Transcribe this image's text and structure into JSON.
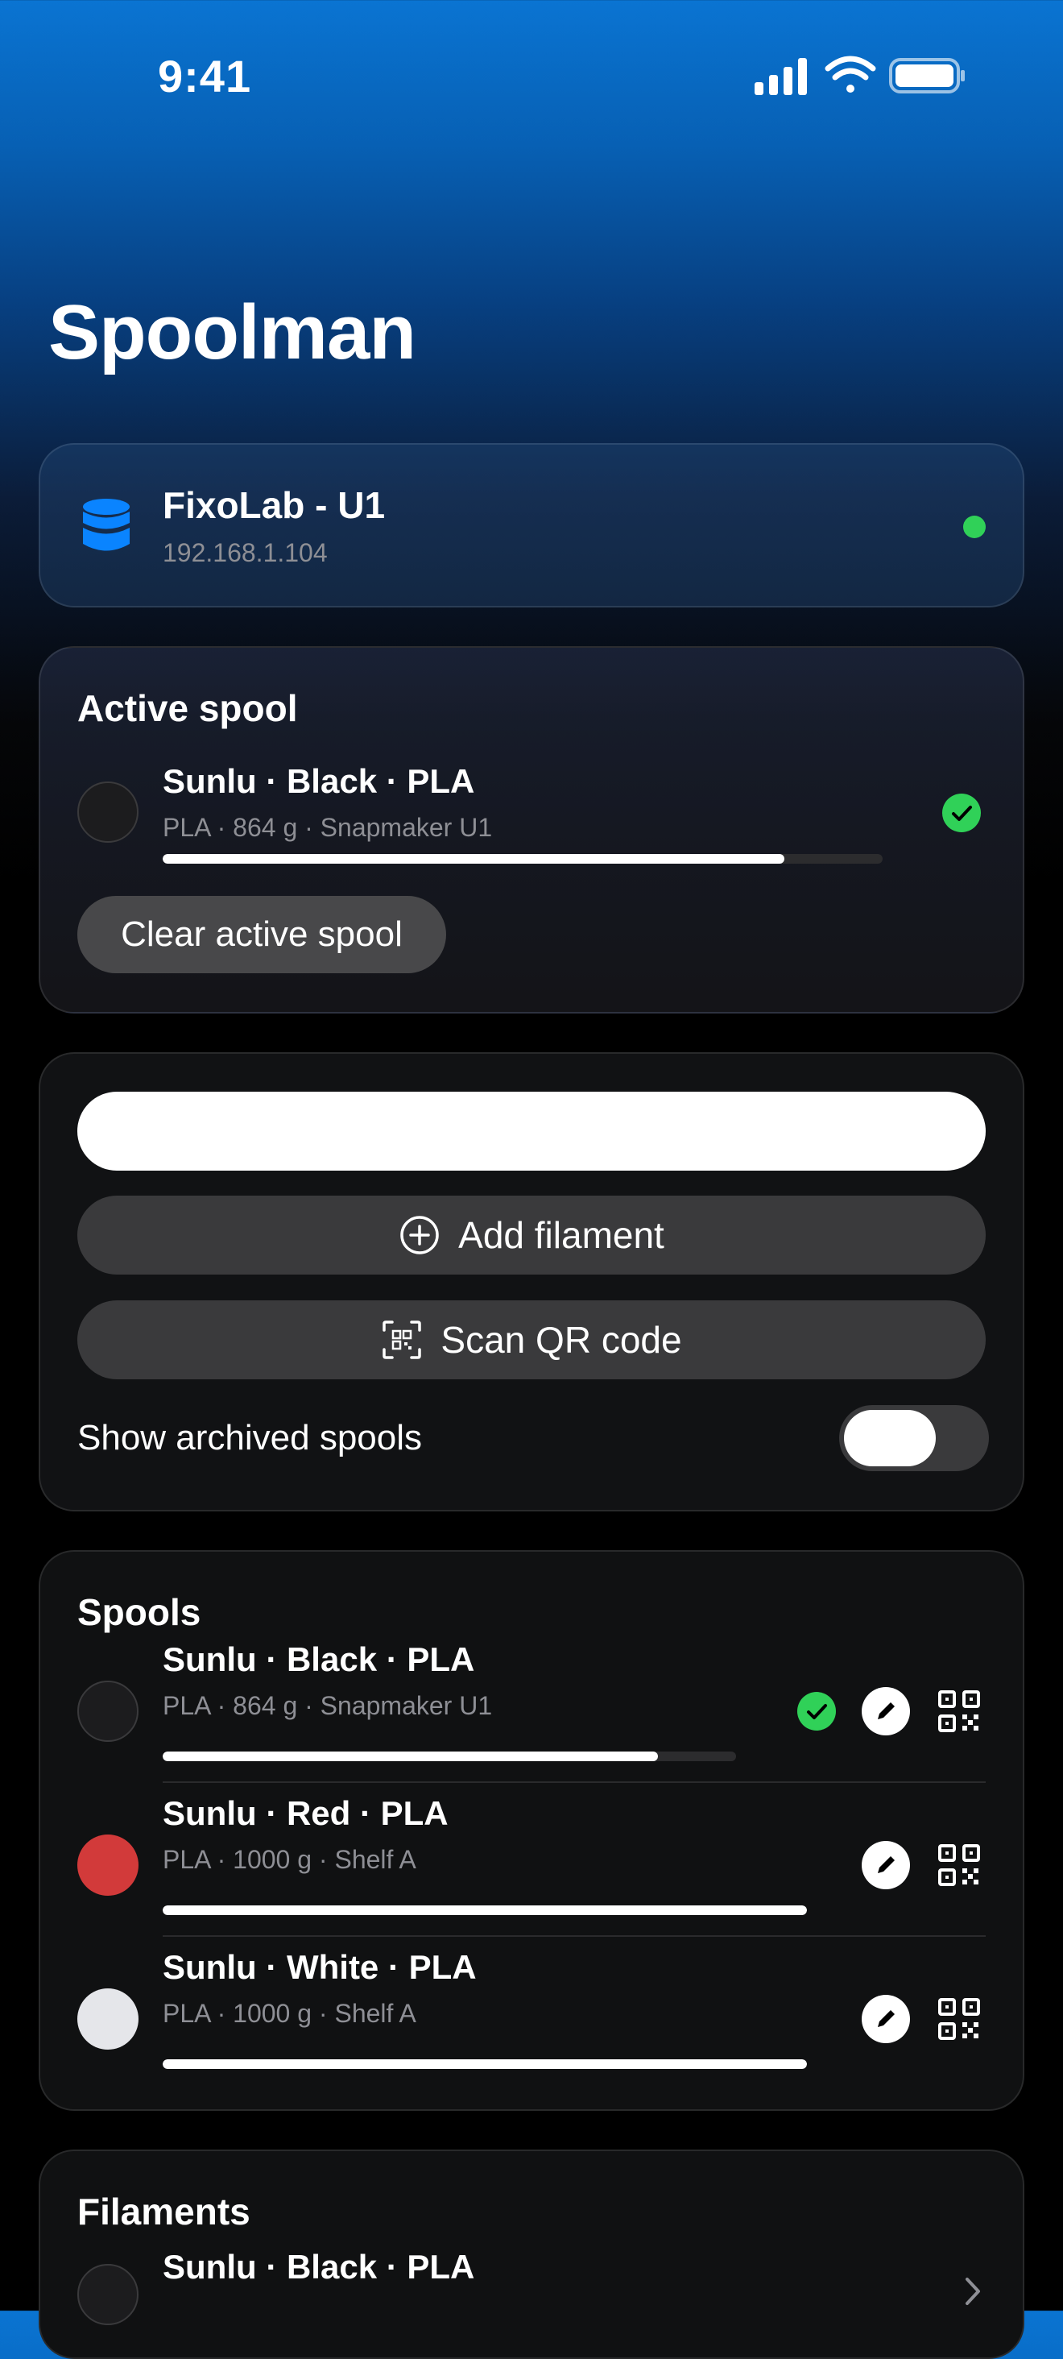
{
  "status_bar": {
    "time": "9:41"
  },
  "header": {
    "title": "Spoolman"
  },
  "server": {
    "name": "FixoLab - U1",
    "address": "192.168.1.104",
    "status_color": "#30d158"
  },
  "active_spool": {
    "section_title": "Active spool",
    "title": "Sunlu · Black · PLA",
    "subtitle": "PLA · 864 g · Snapmaker U1",
    "remaining_fraction": 0.864,
    "color": "#1c1c1e",
    "clear_label": "Clear active spool"
  },
  "controls": {
    "search_value": "",
    "search_placeholder": "",
    "add_filament_label": "Add filament",
    "scan_qr_label": "Scan QR code",
    "show_archived_label": "Show archived spools",
    "show_archived": false
  },
  "spools": {
    "section_title": "Spools",
    "items": [
      {
        "title": "Sunlu · Black · PLA",
        "subtitle": "PLA · 864 g · Snapmaker U1",
        "color": "#1c1c1e",
        "remaining_fraction": 0.864,
        "active": true
      },
      {
        "title": "Sunlu · Red · PLA",
        "subtitle": "PLA · 1000 g · Shelf A",
        "color": "#d23a3a",
        "remaining_fraction": 1.0,
        "active": false
      },
      {
        "title": "Sunlu · White · PLA",
        "subtitle": "PLA · 1000 g · Shelf A",
        "color": "#e5e6ea",
        "remaining_fraction": 1.0,
        "active": false
      }
    ]
  },
  "filaments": {
    "section_title": "Filaments",
    "items": [
      {
        "title": "Sunlu · Black · PLA",
        "color": "#1c1c1e"
      }
    ]
  },
  "colors": {
    "accent": "#0a84ff",
    "success": "#30d158"
  }
}
